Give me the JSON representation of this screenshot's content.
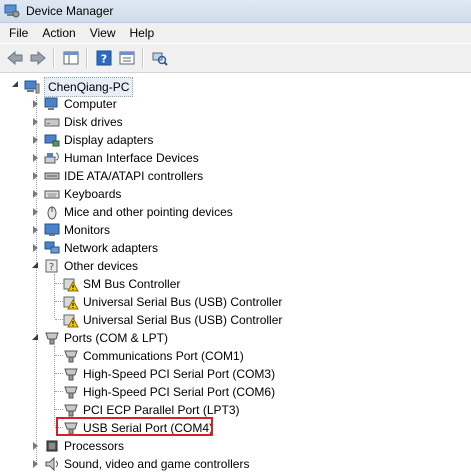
{
  "window": {
    "title": "Device Manager"
  },
  "menu": [
    "File",
    "Action",
    "View",
    "Help"
  ],
  "toolbar": {
    "buttons": [
      "back-icon",
      "forward-icon",
      "console-tree-icon",
      "help-icon",
      "properties-icon",
      "scan-hardware-icon"
    ]
  },
  "tree": {
    "root": "ChenQiang-PC",
    "categories": [
      {
        "label": "Computer",
        "icon": "computer-icon",
        "expanded": false
      },
      {
        "label": "Disk drives",
        "icon": "disk-drive-icon",
        "expanded": false
      },
      {
        "label": "Display adapters",
        "icon": "display-adapter-icon",
        "expanded": false
      },
      {
        "label": "Human Interface Devices",
        "icon": "hid-icon",
        "expanded": false
      },
      {
        "label": "IDE ATA/ATAPI controllers",
        "icon": "ide-controller-icon",
        "expanded": false
      },
      {
        "label": "Keyboards",
        "icon": "keyboard-icon",
        "expanded": false
      },
      {
        "label": "Mice and other pointing devices",
        "icon": "mouse-icon",
        "expanded": false
      },
      {
        "label": "Monitors",
        "icon": "monitor-icon",
        "expanded": false
      },
      {
        "label": "Network adapters",
        "icon": "network-adapter-icon",
        "expanded": false
      },
      {
        "label": "Other devices",
        "icon": "other-devices-icon",
        "expanded": true,
        "children": [
          {
            "label": "SM Bus Controller",
            "icon": "warning-device-icon"
          },
          {
            "label": "Universal Serial Bus (USB) Controller",
            "icon": "warning-device-icon"
          },
          {
            "label": "Universal Serial Bus (USB) Controller",
            "icon": "warning-device-icon"
          }
        ]
      },
      {
        "label": "Ports (COM & LPT)",
        "icon": "port-icon",
        "expanded": true,
        "children": [
          {
            "label": "Communications Port (COM1)",
            "icon": "port-icon"
          },
          {
            "label": "High-Speed PCI Serial Port (COM3)",
            "icon": "port-icon"
          },
          {
            "label": "High-Speed PCI Serial Port (COM6)",
            "icon": "port-icon"
          },
          {
            "label": "PCI ECP Parallel Port (LPT3)",
            "icon": "port-icon"
          },
          {
            "label": "USB Serial Port (COM4)",
            "icon": "port-icon",
            "highlighted": true
          }
        ]
      },
      {
        "label": "Processors",
        "icon": "processor-icon",
        "expanded": false
      },
      {
        "label": "Sound, video and game controllers",
        "icon": "sound-icon",
        "expanded": false
      }
    ]
  },
  "colors": {
    "highlight_border": "#d8202a",
    "warning": "#f5c518"
  }
}
